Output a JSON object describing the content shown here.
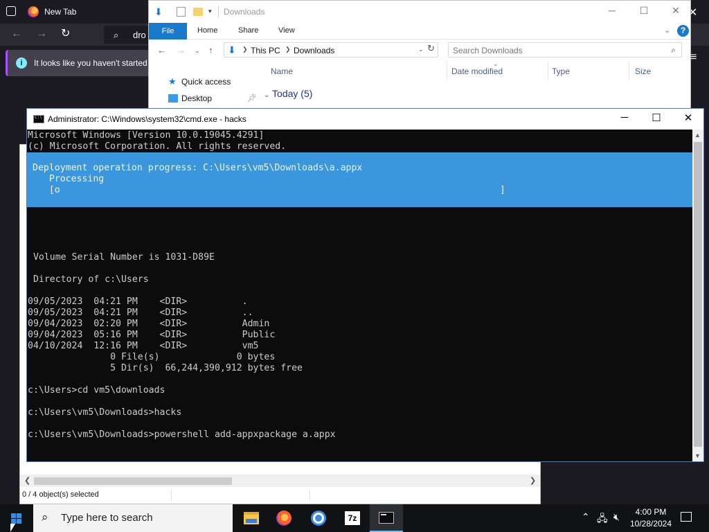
{
  "firefox": {
    "tab_title": "New Tab",
    "url_text": "dro",
    "notification": "It looks like you haven't started l"
  },
  "explorer": {
    "title": "Downloads",
    "ribbon_tabs": [
      "File",
      "Home",
      "Share",
      "View"
    ],
    "help": "?",
    "breadcrumb": [
      "This PC",
      "Downloads"
    ],
    "search_placeholder": "Search Downloads",
    "nav": [
      "Quick access",
      "Desktop"
    ],
    "columns": [
      "Name",
      "Date modified",
      "Type",
      "Size"
    ],
    "group": "Today (5)",
    "status": "0 / 4 object(s) selected"
  },
  "cmd": {
    "title": "Administrator: C:\\Windows\\system32\\cmd.exe - hacks",
    "progress": {
      "line1": "Deployment operation progress: C:\\Users\\vm5\\Downloads\\a.appx",
      "line2": "   Processing",
      "line3": "   [o                                                                                ]"
    },
    "lines": [
      "Microsoft Windows [Version 10.0.19045.4291]",
      "(c) Microsoft Corporation. All rights reserved.",
      "",
      "",
      "",
      "",
      "",
      "",
      "",
      "",
      "",
      " Volume Serial Number is 1031-D89E",
      "",
      " Directory of c:\\Users",
      "",
      "09/05/2023  04:21 PM    <DIR>          .",
      "09/05/2023  04:21 PM    <DIR>          ..",
      "09/04/2023  02:20 PM    <DIR>          Admin",
      "09/04/2023  05:16 PM    <DIR>          Public",
      "04/10/2024  12:16 PM    <DIR>          vm5",
      "               0 File(s)              0 bytes",
      "               5 Dir(s)  66,244,390,912 bytes free",
      "",
      "c:\\Users>cd vm5\\downloads",
      "",
      "c:\\Users\\vm5\\Downloads>hacks",
      "",
      "c:\\Users\\vm5\\Downloads>powershell add-appxpackage a.appx"
    ]
  },
  "taskbar": {
    "search_placeholder": "Type here to search",
    "time": "4:00 PM",
    "date": "10/28/2024",
    "seven_zip": "7z"
  }
}
